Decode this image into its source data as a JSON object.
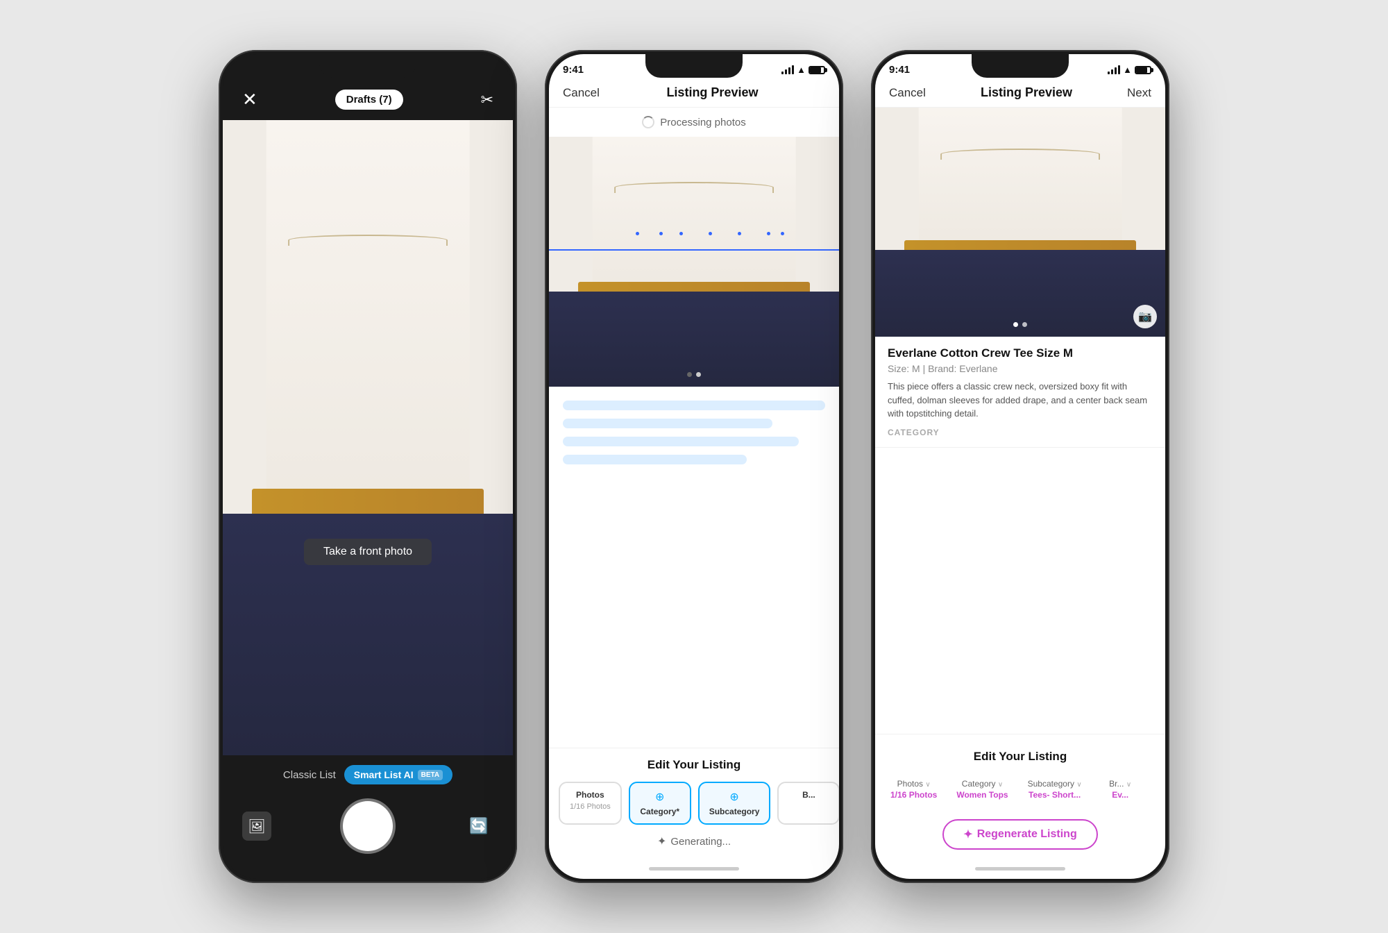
{
  "phone1": {
    "top_bar": {
      "close_label": "✕",
      "drafts_label": "Drafts (7)",
      "scissors_label": "✂"
    },
    "camera": {
      "take_photo_label": "Take a front photo",
      "mode_classic": "Classic List",
      "mode_smart": "Smart List AI",
      "mode_beta": "BETA"
    },
    "bottom_bar": {
      "shutter_label": ""
    }
  },
  "phone2": {
    "status_bar": {
      "time": "9:41",
      "signal": "●●●",
      "wifi": "WiFi",
      "battery": "Battery"
    },
    "nav": {
      "cancel": "Cancel",
      "title": "Listing Preview",
      "next": ""
    },
    "processing": {
      "label": "Processing photos"
    },
    "edit_listing": {
      "title": "Edit Your Listing",
      "tabs": [
        {
          "id": "photos",
          "label": "Photos",
          "value": "1/16 Photos",
          "icon": "⊕",
          "active": false
        },
        {
          "id": "category",
          "label": "Category*",
          "value": "",
          "icon": "⊕",
          "active": true
        },
        {
          "id": "subcategory",
          "label": "Subcategory",
          "value": "",
          "icon": "⊕",
          "active": true
        },
        {
          "id": "brand",
          "label": "B...",
          "value": "",
          "icon": "⊕",
          "active": false
        }
      ]
    },
    "generating": {
      "label": "Generating..."
    }
  },
  "phone3": {
    "status_bar": {
      "time": "9:41"
    },
    "nav": {
      "cancel": "Cancel",
      "title": "Listing Preview",
      "next": "Next"
    },
    "listing": {
      "title": "Everlane Cotton Crew Tee Size M",
      "meta": "Size: M | Brand: Everlane",
      "description": "This piece offers a classic crew neck, oversized boxy fit with cuffed, dolman sleeves for added drape, and a center back seam with topstitching detail.",
      "category_label": "CATEGORY"
    },
    "edit_listing": {
      "title": "Edit Your Listing",
      "tabs": [
        {
          "id": "photos",
          "label": "Photos",
          "chevron": "∨",
          "value": "1/16 Photos"
        },
        {
          "id": "category",
          "label": "Category",
          "chevron": "∨",
          "value": "Women Tops"
        },
        {
          "id": "subcategory",
          "label": "Subcategory",
          "chevron": "∨",
          "value": "Tees- Short..."
        },
        {
          "id": "brand",
          "label": "Br...",
          "chevron": "∨",
          "value": "Ev..."
        }
      ]
    },
    "regen_button": {
      "label": "Regenerate Listing",
      "icon": "✦"
    }
  },
  "colors": {
    "accent_blue": "#1a90d4",
    "accent_pink": "#cc44cc",
    "brand_blue": "#3366ff",
    "text_dark": "#111111",
    "text_mid": "#666666",
    "text_light": "#aaaaaa",
    "bg_white": "#ffffff",
    "bg_phone_dark": "#1a1a1a"
  }
}
